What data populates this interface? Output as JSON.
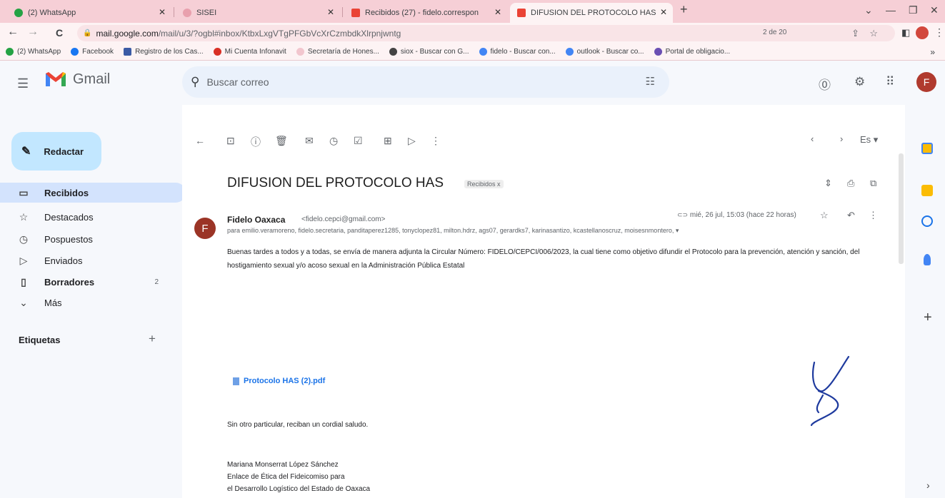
{
  "browser": {
    "tabs": [
      {
        "title": "(2) WhatsApp"
      },
      {
        "title": "SISEI"
      },
      {
        "title": "Recibidos (27) - fidelo.correspon"
      },
      {
        "title": "DIFUSION DEL PROTOCOLO HAS"
      }
    ],
    "url_host": "mail.google.com",
    "url_path": "/mail/u/3/?ogbl#inbox/KtbxLxgVTgPFGbVcXrCzmbdkXlrpnjwntg",
    "bookmarks": [
      "(2) WhatsApp",
      "Facebook",
      "Registro de los Cas...",
      "Mi Cuenta Infonavit",
      "Secretaría de Hones...",
      "siox - Buscar con G...",
      "fidelo - Buscar con...",
      "outlook - Buscar co...",
      "Portal de obligacio..."
    ],
    "bookmarks_more": "»"
  },
  "gmail": {
    "logo_text": "Gmail",
    "search_placeholder": "Buscar correo",
    "avatar_letter": "F",
    "compose_label": "Redactar",
    "nav": [
      {
        "label": "Recibidos",
        "icon": "inbox-icon",
        "count": ""
      },
      {
        "label": "Destacados",
        "icon": "star-icon",
        "count": ""
      },
      {
        "label": "Pospuestos",
        "icon": "clock-icon",
        "count": ""
      },
      {
        "label": "Enviados",
        "icon": "send-icon",
        "count": ""
      },
      {
        "label": "Borradores",
        "icon": "draft-icon",
        "count": "2"
      },
      {
        "label": "Más",
        "icon": "chevron-down-icon",
        "count": ""
      }
    ],
    "labels_heading": "Etiquetas",
    "pagination": "2 de 20",
    "lang": "Es"
  },
  "message": {
    "subject": "DIFUSION DEL PROTOCOLO HAS",
    "label_chip": "Recibidos x",
    "sender_initial": "F",
    "sender_name": "Fidelo Oaxaca",
    "sender_email": "<fidelo.cepci@gmail.com>",
    "recipients": "para emilio.veramoreno, fidelo.secretaria, panditaperez1285, tonyclopez81, milton.hdrz, ags07, gerardks7, karinasantizo, kcastellanoscruz, moisesnmontero,",
    "date": "mié, 26 jul, 15:03 (hace 22 horas)",
    "body": "Buenas tardes a todos y a todas, se envía de manera adjunta la Circular Número: FIDELO/CEPCI/006/2023, la cual tiene como objetivo difundir el Protocolo para la prevención, atención y sanción, del hostigamiento sexual y/o acoso sexual en la Administración Pública Estatal",
    "attachment": "Protocolo HAS (2).pdf",
    "greeting": "Sin otro particular, reciban un cordial saludo.",
    "signature": [
      "Mariana Monserrat López Sánchez",
      "Enlace de Ética del Fideicomiso para",
      "el Desarrollo Logístico del Estado de Oaxaca"
    ]
  },
  "colors": {
    "tabstrip": "#f6cfd6",
    "compose": "#c2e7ff",
    "selected_nav": "#d3e3fd",
    "link": "#1a73e8"
  }
}
